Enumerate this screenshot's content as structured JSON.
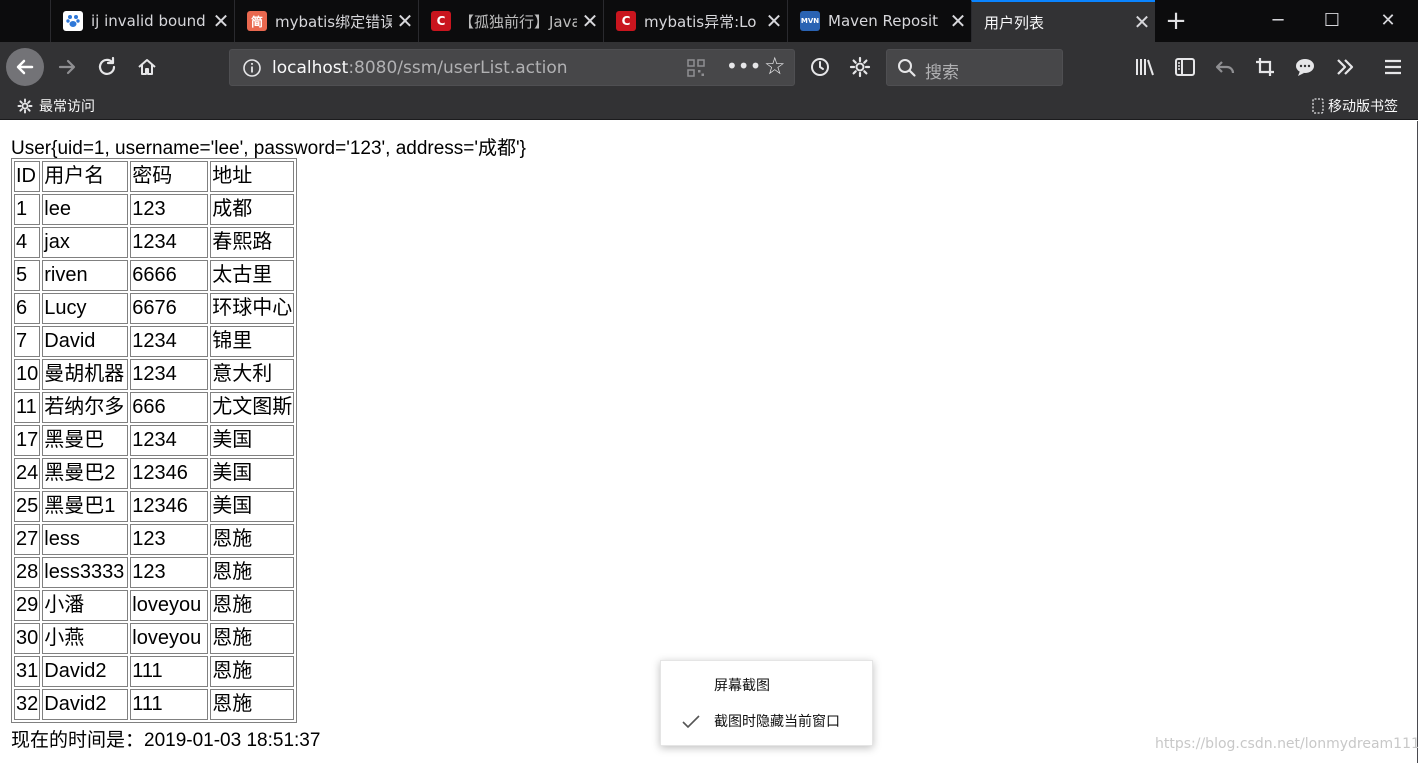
{
  "tabs": [
    {
      "title": "ij invalid bound",
      "favicon_color": "#2f78d8",
      "favicon_glyph": "🐾"
    },
    {
      "title": "mybatis绑定错误",
      "favicon_color": "#e9684f",
      "favicon_glyph": "简"
    },
    {
      "title": "【孤独前行】Java",
      "favicon_color": "#c9151e",
      "favicon_glyph": "C"
    },
    {
      "title": "mybatis异常:Lo",
      "favicon_color": "#c9151e",
      "favicon_glyph": "C"
    },
    {
      "title": "Maven Reposit",
      "favicon_color": "#2a63b3",
      "favicon_glyph": "MVN"
    },
    {
      "title": "用户列表",
      "favicon_color": "",
      "favicon_glyph": ""
    }
  ],
  "url": {
    "host": "localhost",
    "rest": ":8080/ssm/userList.action"
  },
  "search_placeholder": "搜索",
  "bookmarks": {
    "left": "最常访问",
    "right": "移动版书签"
  },
  "page": {
    "user_line": "User{uid=1, username='lee', password='123', address='成都'}",
    "table_header": [
      "ID",
      "用户名",
      "密码",
      "地址"
    ],
    "table_rows": [
      [
        "1",
        "lee",
        "123",
        "成都"
      ],
      [
        "4",
        "jax",
        "1234",
        "春熙路"
      ],
      [
        "5",
        "riven",
        "6666",
        "太古里"
      ],
      [
        "6",
        "Lucy",
        "6676",
        "环球中心"
      ],
      [
        "7",
        "David",
        "1234",
        "锦里"
      ],
      [
        "10",
        "曼胡机器",
        "1234",
        "意大利"
      ],
      [
        "11",
        "若纳尔多",
        "666",
        "尤文图斯"
      ],
      [
        "17",
        "黑曼巴",
        "1234",
        "美国"
      ],
      [
        "24",
        "黑曼巴2",
        "12346",
        "美国"
      ],
      [
        "25",
        "黑曼巴1",
        "12346",
        "美国"
      ],
      [
        "27",
        "less",
        "123",
        "恩施"
      ],
      [
        "28",
        "less3333",
        "123",
        "恩施"
      ],
      [
        "29",
        "小潘",
        "loveyou",
        "恩施"
      ],
      [
        "30",
        "小燕",
        "loveyou",
        "恩施"
      ],
      [
        "31",
        "David2",
        "111",
        "恩施"
      ],
      [
        "32",
        "David2",
        "111",
        "恩施"
      ]
    ],
    "time_line": "现在的时间是：2019-01-03 18:51:37"
  },
  "context_menu": {
    "item1": "屏幕截图",
    "item2": "截图时隐藏当前窗口"
  },
  "watermark": "https://blog.csdn.net/lonmydream111",
  "colors": {
    "tab_bg": "#0c0c0d",
    "toolbar_bg": "#323234",
    "active_accent": "#0a84ff"
  }
}
